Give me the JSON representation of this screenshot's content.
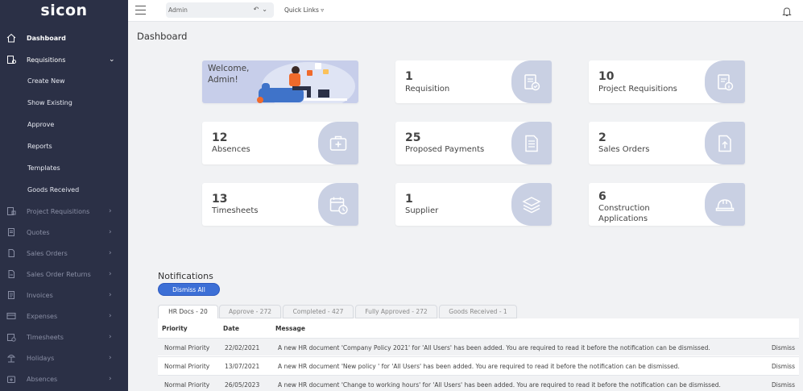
{
  "app": {
    "logo": "sicon"
  },
  "sidebar": {
    "items": [
      {
        "label": "Dashboard",
        "icon": "home-icon"
      },
      {
        "label": "Requisitions",
        "icon": "requisitions-icon",
        "chevron": "⌄"
      },
      {
        "label": "Create New"
      },
      {
        "label": "Show Existing"
      },
      {
        "label": "Approve"
      },
      {
        "label": "Reports"
      },
      {
        "label": "Templates"
      },
      {
        "label": "Goods Received"
      },
      {
        "label": "Project Requisitions",
        "icon": "project-requisitions-icon",
        "chevron": "›"
      },
      {
        "label": "Quotes",
        "icon": "quotes-icon",
        "chevron": "›"
      },
      {
        "label": "Sales Orders",
        "icon": "sales-orders-icon",
        "chevron": "›"
      },
      {
        "label": "Sales Order Returns",
        "icon": "sales-order-returns-icon",
        "chevron": "›"
      },
      {
        "label": "Invoices",
        "icon": "invoices-icon",
        "chevron": "›"
      },
      {
        "label": "Expenses",
        "icon": "expenses-icon",
        "chevron": "›"
      },
      {
        "label": "Timesheets",
        "icon": "timesheets-icon",
        "chevron": "›"
      },
      {
        "label": "Holidays",
        "icon": "holidays-icon",
        "chevron": "›"
      },
      {
        "label": "Absences",
        "icon": "absences-icon",
        "chevron": "›"
      }
    ]
  },
  "topbar": {
    "admin_value": "Admin",
    "quick_links": "Quick Links ▿"
  },
  "page": {
    "title": "Dashboard"
  },
  "welcome": {
    "line1": "Welcome,",
    "line2": "Admin!"
  },
  "cards": [
    {
      "number": "1",
      "label": "Requisition",
      "icon": "requisition-check-icon"
    },
    {
      "number": "10",
      "label": "Project Requisitions",
      "icon": "project-requisitions-info-icon"
    },
    {
      "number": "12",
      "label": "Absences",
      "icon": "medical-kit-icon"
    },
    {
      "number": "25",
      "label": "Proposed Payments",
      "icon": "document-icon"
    },
    {
      "number": "2",
      "label": "Sales Orders",
      "icon": "file-upload-icon"
    },
    {
      "number": "13",
      "label": "Timesheets",
      "icon": "calendar-clock-icon"
    },
    {
      "number": "1",
      "label": "Supplier",
      "icon": "layers-icon"
    },
    {
      "number": "6",
      "label_line1": "Construction",
      "label_line2": "Applications",
      "icon": "hard-hat-icon"
    }
  ],
  "notifications": {
    "title": "Notifications",
    "dismiss_all": "Dismiss All",
    "tabs": [
      {
        "label": "HR Docs - 20",
        "active": true
      },
      {
        "label": "Approve - 272"
      },
      {
        "label": "Completed - 427"
      },
      {
        "label": "Fully Approved - 272"
      },
      {
        "label": "Goods Received - 1"
      }
    ],
    "columns": {
      "priority": "Priority",
      "date": "Date",
      "message": "Message"
    },
    "rows": [
      {
        "priority": "Normal Priority",
        "date": "22/02/2021",
        "message": "A new HR document 'Company Policy 2021' for 'All Users' has been added. You are required to read it before the notification can be dismissed.",
        "action": "Dismiss"
      },
      {
        "priority": "Normal Priority",
        "date": "13/07/2021",
        "message": "A new HR document 'New policy ' for 'All Users' has been added. You are required to read it before the notification can be dismissed.",
        "action": "Dismiss"
      },
      {
        "priority": "Normal Priority",
        "date": "26/05/2023",
        "message": "A new HR document 'Change to working hours' for 'All Users' has been added. You are required to read it before the notification can be dismissed.",
        "action": "Dismiss"
      }
    ]
  },
  "colors": {
    "sidebar_bg": "#2b3046",
    "accent": "#3c6fd6",
    "card_icon_panel": "#c9d0e3",
    "welcome_bg": "#c7ceea"
  }
}
